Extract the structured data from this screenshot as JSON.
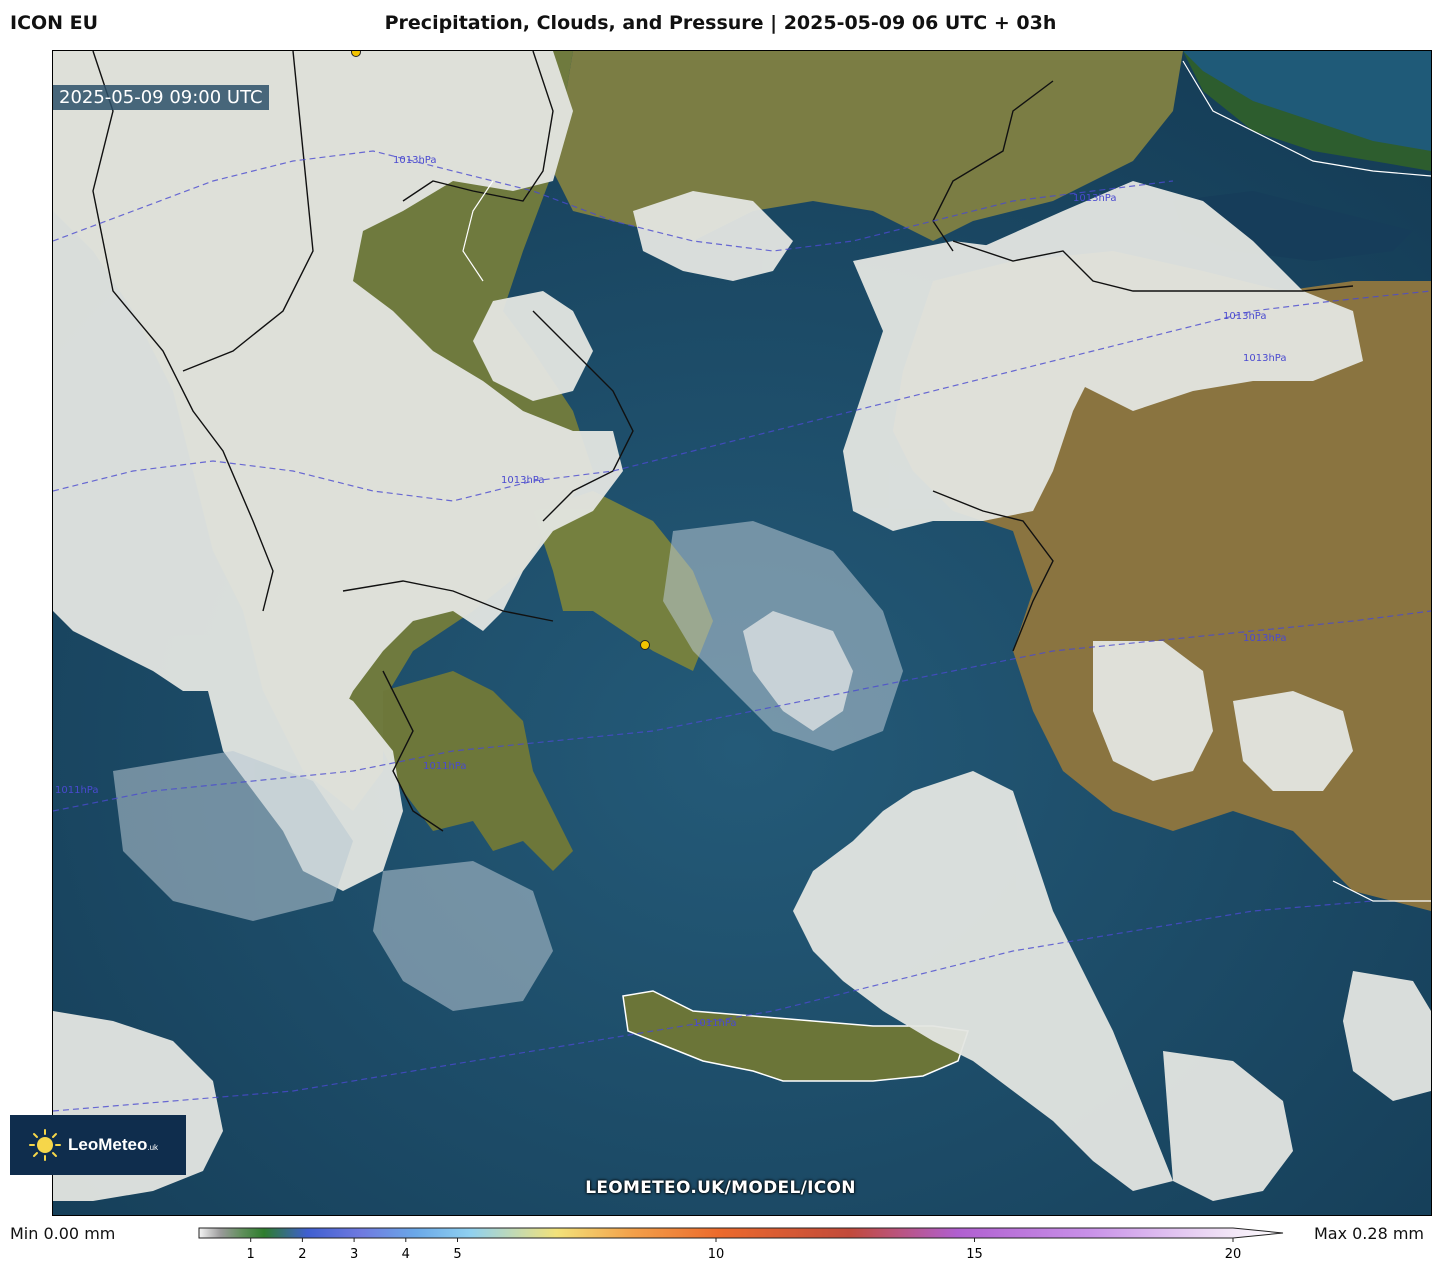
{
  "header": {
    "model": "ICON EU",
    "title": "Precipitation, Clouds, and Pressure | 2025-05-09 06 UTC + 03h"
  },
  "map": {
    "valid_time": "2025-05-09 09:00 UTC",
    "watermark": "LEOMETEO.UK/MODEL/ICON",
    "isobar_labels": [
      "1013hPa",
      "1013hPa",
      "1013hPa",
      "1013hPa",
      "1013hPa",
      "1011hPa",
      "1011hPa",
      "1013hPa",
      "1011hPa"
    ],
    "colors": {
      "sea": "#1d4b67",
      "land": "#7a7a3e",
      "cloud": "#e6e8e4",
      "isobar": "#4a4ad0"
    }
  },
  "logo": {
    "brand": "LeoMeteo",
    "suffix": ".uk",
    "icon": "sun-icon"
  },
  "legend": {
    "min_label": "Min 0.00 mm",
    "max_label": "Max 0.28 mm",
    "ticks": [
      "1",
      "2",
      "3",
      "4",
      "5",
      "10",
      "15",
      "20"
    ],
    "tick_values": [
      1,
      2,
      3,
      4,
      5,
      10,
      15,
      20
    ],
    "range": [
      0,
      20
    ]
  }
}
